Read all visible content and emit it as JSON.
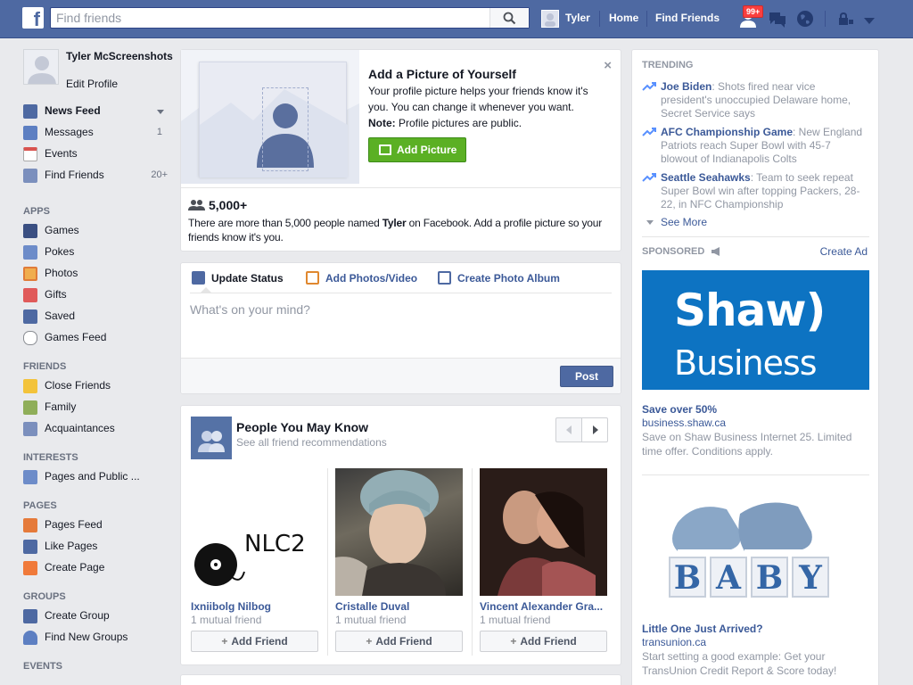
{
  "header": {
    "search_placeholder": "Find friends",
    "user_name": "Tyler",
    "home_label": "Home",
    "find_friends_label": "Find Friends",
    "notification_count": "99+"
  },
  "profile": {
    "name": "Tyler McScreenshots",
    "edit_label": "Edit Profile"
  },
  "leftnav": {
    "top_items": [
      {
        "label": "News Feed",
        "count": ""
      },
      {
        "label": "Messages",
        "count": "1"
      },
      {
        "label": "Events",
        "count": ""
      },
      {
        "label": "Find Friends",
        "count": "20+"
      }
    ],
    "apps_header": "APPS",
    "apps": [
      "Games",
      "Pokes",
      "Photos",
      "Gifts",
      "Saved",
      "Games Feed"
    ],
    "friends_header": "FRIENDS",
    "friends": [
      "Close Friends",
      "Family",
      "Acquaintances"
    ],
    "interests_header": "INTERESTS",
    "interests": [
      "Pages and Public ..."
    ],
    "pages_header": "PAGES",
    "pages": [
      "Pages Feed",
      "Like Pages",
      "Create Page"
    ],
    "groups_header": "GROUPS",
    "groups": [
      "Create Group",
      "Find New Groups"
    ],
    "events_header": "EVENTS"
  },
  "add_picture": {
    "title": "Add a Picture of Yourself",
    "desc": "Your profile picture helps your friends know it's you. You can change it whenever you want.",
    "note_label": "Note:",
    "note_text": " Profile pictures are public.",
    "button_label": "Add Picture",
    "close_glyph": "×",
    "count": "5,000+",
    "people_note_before": "There are more than 5,000 people named ",
    "people_note_name": "Tyler",
    "people_note_after": " on Facebook. Add a profile picture so your friends know it's you."
  },
  "composer": {
    "tab_status": "Update Status",
    "tab_photos": "Add Photos/Video",
    "tab_album": "Create Photo Album",
    "placeholder": "What's on your mind?",
    "post_label": "Post"
  },
  "pymk": {
    "title": "People You May Know",
    "subtitle": "See all friend recommendations",
    "add_label": "Add Friend",
    "people": [
      {
        "name": "Ixniibolg Nilbog",
        "mutual": "1 mutual friend",
        "photo_text": "NLC2"
      },
      {
        "name": "Cristalle Duval",
        "mutual": "1 mutual friend"
      },
      {
        "name": "Vincent Alexander Gra...",
        "mutual": "1 mutual friend"
      }
    ]
  },
  "trending": {
    "header": "TRENDING",
    "items": [
      {
        "topic": "Joe Biden",
        "text": ": Shots fired near vice president's unoccupied Delaware home, Secret Service says"
      },
      {
        "topic": "AFC Championship Game",
        "text": ": New England Patriots reach Super Bowl with 45-7 blowout of Indianapolis Colts"
      },
      {
        "topic": "Seattle Seahawks",
        "text": ": Team to seek repeat Super Bowl win after topping Packers, 28-22, in NFC Championship"
      }
    ],
    "see_more": "See More"
  },
  "sponsored": {
    "header": "SPONSORED",
    "create_ad": "Create Ad",
    "ads": [
      {
        "logo_line1": "Shaw)",
        "logo_line2": "Business",
        "title": "Save over 50%",
        "url": "business.shaw.ca",
        "desc": "Save on Shaw Business Internet 25. Limited time offer. Conditions apply."
      },
      {
        "blocks_text": "BABY",
        "title": "Little One Just Arrived?",
        "url": "transunion.ca",
        "desc": "Start setting a good example: Get your TransUnion Credit Report & Score today!"
      }
    ]
  },
  "colors": {
    "brand": "#4e69a2",
    "link": "#3b5998",
    "green_button": "#5bb024",
    "notification": "#fa3e3e",
    "shaw_blue": "#0d73c2"
  },
  "icons": [
    "facebook-logo",
    "search-icon",
    "friend-requests-icon",
    "messages-icon",
    "globe-icon",
    "privacy-lock-icon",
    "chevron-down-icon"
  ]
}
